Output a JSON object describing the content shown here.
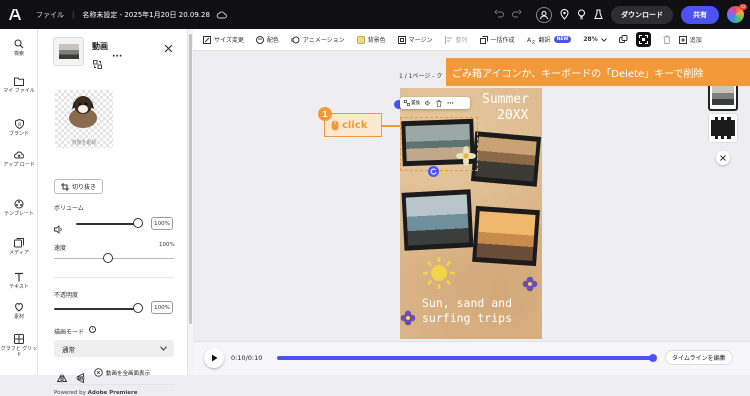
{
  "topbar": {
    "file_menu": "ファイル",
    "doc_title": "名称未設定 - 2025年1月20日 20.09.28",
    "download": "ダウンロード",
    "share": "共有"
  },
  "rail": [
    "検索",
    "マイ ファイル",
    "ブランド",
    "アップ ロード",
    "テンプレート",
    "メディア",
    "テキスト",
    "素材",
    "グラフと グリッド"
  ],
  "panel": {
    "title": "動画",
    "remove_bg": "背景を削除",
    "crop": "切り抜き",
    "volume_label": "ボリューム",
    "volume_value": "100%",
    "speed_label": "速度",
    "speed_value": "100%",
    "opacity_label": "不透明度",
    "opacity_value": "100%",
    "blend_label": "描画モード",
    "blend_value": "通常",
    "fullscreen": "動画を全画面表示",
    "powered_prefix": "Powered by ",
    "powered_brand": "Adobe Premiere",
    "volume_level": 1.0,
    "speed_level": 0.45,
    "opacity_level": 1.0
  },
  "toolbar": {
    "resize": "サイズ変更",
    "color": "配色",
    "animation": "アニメーション",
    "bg_color": "背景色",
    "margin": "マージン",
    "align": "整列",
    "bulk": "一括作成",
    "translate": "翻訳",
    "new_badge": "NEW",
    "zoom": "28%",
    "add": "追加"
  },
  "canvas": {
    "page_label": "1 / 1ページ - ク",
    "headline_1": "Summer",
    "headline_2": "20XX",
    "tagline_1": "Sun, sand and",
    "tagline_2": "surfing trips",
    "mini_replace": "置換"
  },
  "annotation": {
    "banner": "ごみ箱アイコンか、キーボードの「Delete」キーで削除",
    "step": "1",
    "click": "click"
  },
  "timeline": {
    "time": "0:10/0:10",
    "button": "タイムラインを編集",
    "progress": 1.0
  },
  "colors": {
    "accent": "#4c53f0",
    "annotation": "#f29a3a",
    "poster_bg": "#dcb88c"
  }
}
